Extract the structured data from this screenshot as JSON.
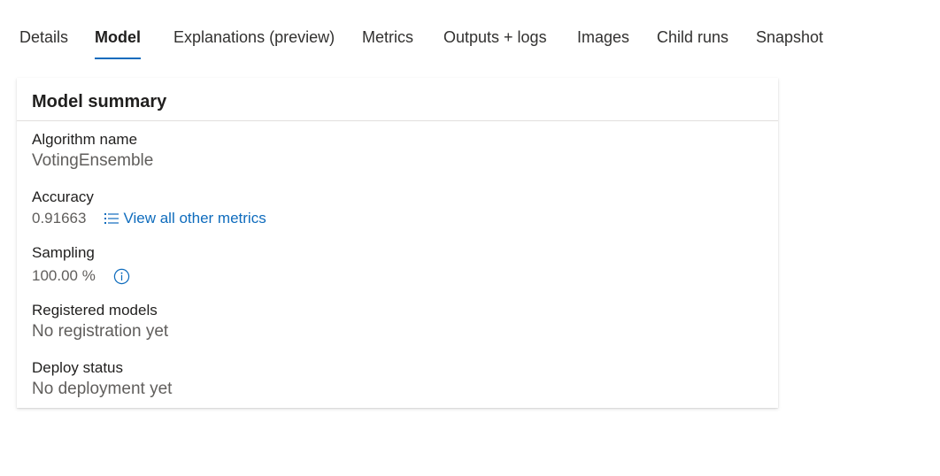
{
  "tabs": [
    {
      "label": "Details",
      "active": false
    },
    {
      "label": "Model",
      "active": true
    },
    {
      "label": "Explanations (preview)",
      "active": false
    },
    {
      "label": "Metrics",
      "active": false
    },
    {
      "label": "Outputs + logs",
      "active": false
    },
    {
      "label": "Images",
      "active": false
    },
    {
      "label": "Child runs",
      "active": false
    },
    {
      "label": "Snapshot",
      "active": false
    }
  ],
  "card": {
    "title": "Model summary",
    "algorithm": {
      "label": "Algorithm name",
      "value": "VotingEnsemble"
    },
    "accuracy": {
      "label": "Accuracy",
      "value": "0.91663",
      "link_label": "View all other metrics",
      "link_icon": "list-icon"
    },
    "sampling": {
      "label": "Sampling",
      "value": "100.00 %",
      "info_icon": "info-icon"
    },
    "registered": {
      "label": "Registered models",
      "value": "No registration yet"
    },
    "deploy": {
      "label": "Deploy status",
      "value": "No deployment yet"
    }
  },
  "colors": {
    "accent": "#0f6cbd",
    "text": "#201f1e",
    "secondary_text": "#605e5c",
    "divider": "#e1dfdd"
  }
}
